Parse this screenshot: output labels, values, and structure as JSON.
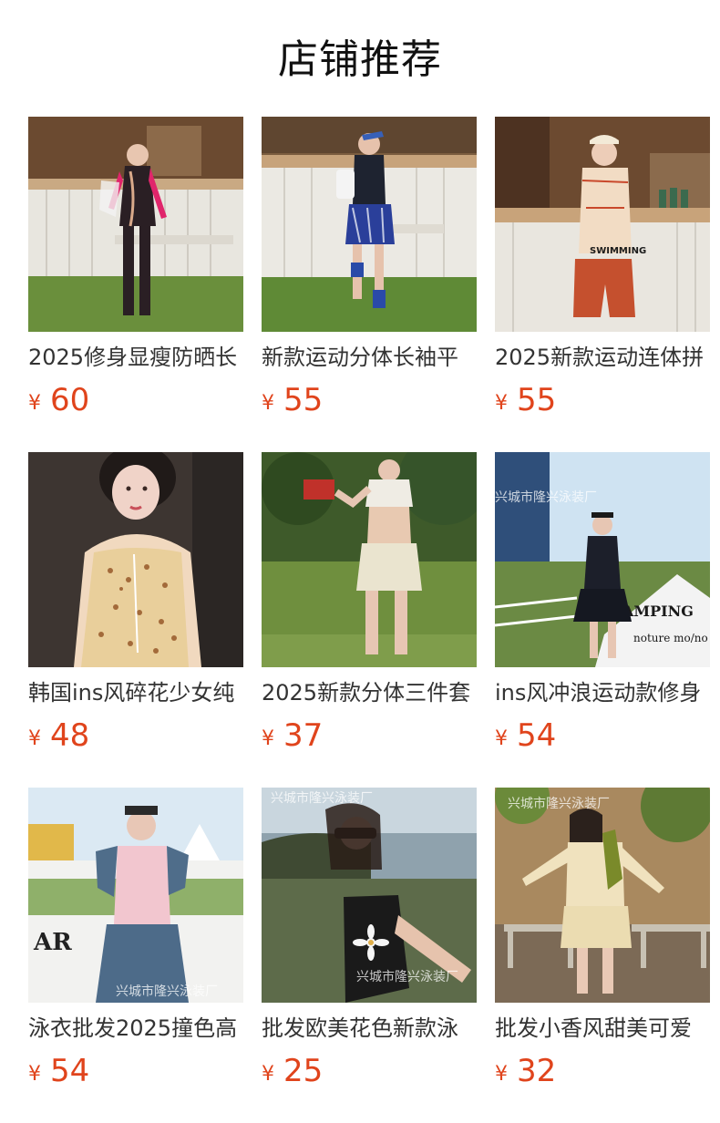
{
  "header": {
    "title": "店铺推荐"
  },
  "currency_symbol": "¥",
  "products": [
    {
      "name": "2025修身显瘦防晒长",
      "price": "60",
      "icon": "product-photo"
    },
    {
      "name": "新款运动分体长袖平",
      "price": "55",
      "icon": "product-photo"
    },
    {
      "name": "2025新款运动连体拼",
      "price": "55",
      "icon": "product-photo"
    },
    {
      "name": "韩国ins风碎花少女纯",
      "price": "48",
      "icon": "product-photo"
    },
    {
      "name": "2025新款分体三件套",
      "price": "37",
      "icon": "product-photo"
    },
    {
      "name": "ins风冲浪运动款修身",
      "price": "54",
      "icon": "product-photo"
    },
    {
      "name": "泳衣批发2025撞色高",
      "price": "54",
      "icon": "product-photo"
    },
    {
      "name": "批发欧美花色新款泳",
      "price": "25",
      "icon": "product-photo"
    },
    {
      "name": "批发小香风甜美可爱",
      "price": "32",
      "icon": "product-photo"
    }
  ],
  "watermark": "兴城市隆兴泳装厂",
  "image_texts": {
    "swimming": "SWIMMING",
    "camping": "AMPING",
    "nature": "noture mo/no",
    "ar": "AR"
  },
  "colors": {
    "price": "#e0441c",
    "title": "#111111",
    "name": "#333333"
  }
}
